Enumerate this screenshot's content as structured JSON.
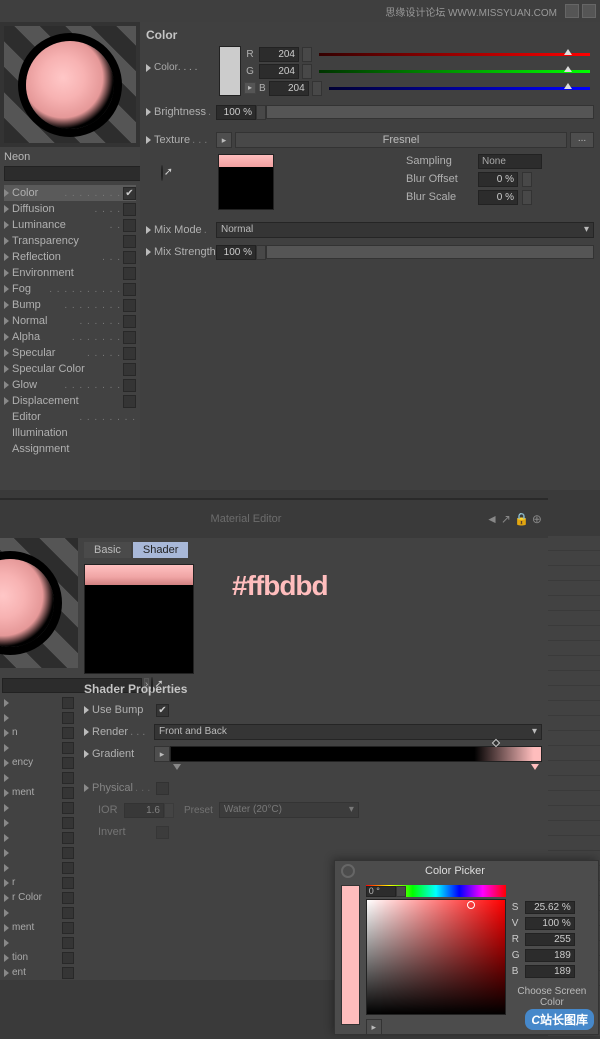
{
  "topbar": {
    "brand": "思缘设计论坛 WWW.MISSYUAN.COM"
  },
  "material": {
    "name": "Neon"
  },
  "section1": {
    "title": "Color",
    "color_label": "Color",
    "brightness_label": "Brightness",
    "brightness_value": "100 %",
    "texture_label": "Texture",
    "texture_value": "Fresnel",
    "mixmode_label": "Mix Mode",
    "mixmode_value": "Normal",
    "mixstrength_label": "Mix Strength",
    "mixstrength_value": "100 %",
    "rgb": {
      "r_label": "R",
      "r": "204",
      "g_label": "G",
      "g": "204",
      "b_label": "B",
      "b": "204"
    },
    "sampling_label": "Sampling",
    "sampling_value": "None",
    "bluroffset_label": "Blur Offset",
    "bluroffset_value": "0 %",
    "blurscale_label": "Blur Scale",
    "blurscale_value": "0 %"
  },
  "channels": [
    {
      "label": "Color",
      "sel": true,
      "checked": true,
      "tri": true,
      "ck": true,
      "dots": ". . . . . . . ."
    },
    {
      "label": "Diffusion",
      "sel": false,
      "checked": false,
      "tri": true,
      "ck": true,
      "dots": ". . . ."
    },
    {
      "label": "Luminance",
      "sel": false,
      "checked": false,
      "tri": true,
      "ck": true,
      "dots": ". ."
    },
    {
      "label": "Transparency",
      "sel": false,
      "checked": false,
      "tri": true,
      "ck": true,
      "dots": ""
    },
    {
      "label": "Reflection",
      "sel": false,
      "checked": false,
      "tri": true,
      "ck": true,
      "dots": ". . ."
    },
    {
      "label": "Environment",
      "sel": false,
      "checked": false,
      "tri": true,
      "ck": true,
      "dots": ""
    },
    {
      "label": "Fog",
      "sel": false,
      "checked": false,
      "tri": true,
      "ck": true,
      "dots": ". . . . . . . . . ."
    },
    {
      "label": "Bump",
      "sel": false,
      "checked": false,
      "tri": true,
      "ck": true,
      "dots": ". . . . . . . ."
    },
    {
      "label": "Normal",
      "sel": false,
      "checked": false,
      "tri": true,
      "ck": true,
      "dots": ". . . . . ."
    },
    {
      "label": "Alpha",
      "sel": false,
      "checked": false,
      "tri": true,
      "ck": true,
      "dots": ". . . . . . ."
    },
    {
      "label": "Specular",
      "sel": false,
      "checked": false,
      "tri": true,
      "ck": true,
      "dots": ". . . . ."
    },
    {
      "label": "Specular Color",
      "sel": false,
      "checked": false,
      "tri": true,
      "ck": true,
      "dots": ""
    },
    {
      "label": "Glow",
      "sel": false,
      "checked": false,
      "tri": true,
      "ck": true,
      "dots": ". . . . . . . ."
    },
    {
      "label": "Displacement",
      "sel": false,
      "checked": false,
      "tri": true,
      "ck": true,
      "dots": ""
    },
    {
      "label": "Editor",
      "sel": false,
      "checked": false,
      "tri": false,
      "ck": false,
      "dots": ". . . . . . . ."
    },
    {
      "label": "Illumination",
      "sel": false,
      "checked": false,
      "tri": false,
      "ck": false,
      "dots": ""
    },
    {
      "label": "Assignment",
      "sel": false,
      "checked": false,
      "tri": false,
      "ck": false,
      "dots": ""
    }
  ],
  "panel2": {
    "title": "Material Editor",
    "tabs": {
      "basic": "Basic",
      "shader": "Shader"
    },
    "hex": "#ffbdbd",
    "section_title": "Shader Properties",
    "usebump_label": "Use Bump",
    "render_label": "Render",
    "render_value": "Front and Back",
    "gradient_label": "Gradient",
    "physical_label": "Physical",
    "ior_label": "IOR",
    "ior_value": "1.6",
    "preset_label": "Preset",
    "preset_value": "Water (20°C)",
    "invert_label": "Invert"
  },
  "channels2": [
    "",
    "",
    "n",
    "",
    "ency",
    "",
    "ment",
    "",
    "",
    "",
    "",
    "",
    "r",
    "r Color",
    "",
    "ment",
    "",
    "tion",
    "ent"
  ],
  "colorpicker": {
    "title": "Color Picker",
    "hue": "0 °",
    "s_label": "S",
    "s": "25.62 %",
    "v_label": "V",
    "v": "100 %",
    "r_label": "R",
    "r": "255",
    "g_label": "G",
    "g": "189",
    "b_label": "B",
    "b": "189",
    "choose": "Choose Screen Color"
  },
  "watermark": "站长图库"
}
